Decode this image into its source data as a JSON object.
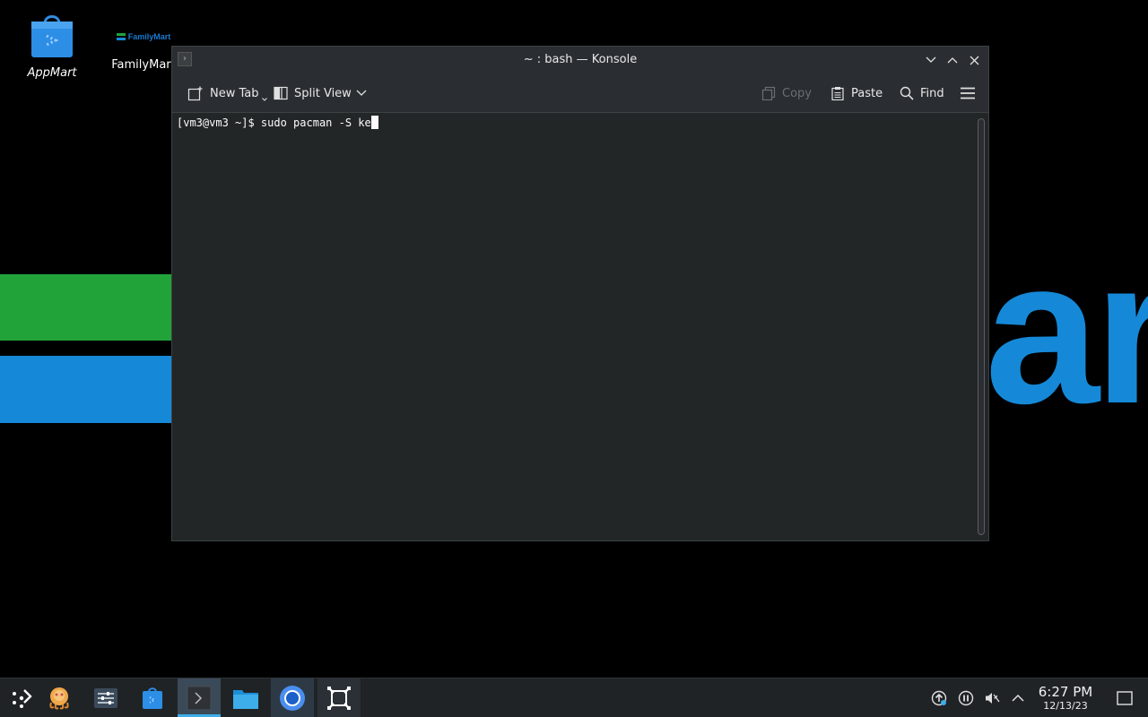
{
  "desktop": {
    "wallpaper_text": "art",
    "icons": [
      {
        "label": "AppMart"
      },
      {
        "label": "FamilyMart",
        "logo_text": "FamilyMart"
      }
    ]
  },
  "window": {
    "title": "~ : bash — Konsole",
    "toolbar": {
      "new_tab": "New Tab",
      "split_view": "Split View",
      "copy": "Copy",
      "paste": "Paste",
      "find": "Find"
    },
    "terminal": {
      "prompt": "[vm3@vm3 ~]$ ",
      "command": "sudo pacman -S ke"
    }
  },
  "taskbar": {
    "clock_time": "6:27 PM",
    "clock_date": "12/13/23",
    "apps": [
      "app-launcher-icon",
      "octopi-icon",
      "system-settings-icon",
      "appmart-icon",
      "konsole-icon",
      "file-manager-icon",
      "chromium-icon",
      "window-manager-icon"
    ],
    "tray": [
      "update-icon",
      "pause-icon",
      "volume-muted-icon",
      "chevron-up-icon",
      "show-desktop-icon"
    ]
  },
  "colors": {
    "accent": "#3daee9",
    "wallpaper_green": "#21a33a",
    "wallpaper_blue": "#1589d8",
    "terminal_bg": "#232627"
  }
}
